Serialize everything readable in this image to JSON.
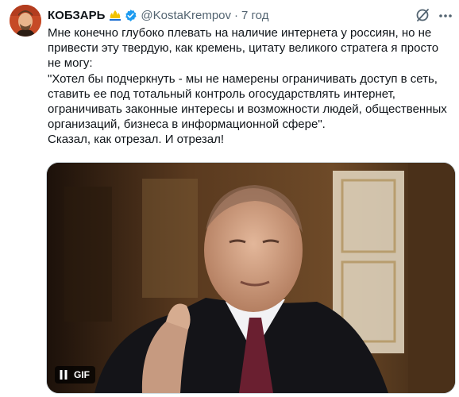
{
  "tweet": {
    "author_name": "КОБЗАРЬ",
    "handle": "@KostaKrempov",
    "separator": "·",
    "time": "7 год",
    "body": [
      "Мне конечно глубоко плевать на наличие интернета у россиян, но не привести эту твердую, как кремень, цитату великого стратега я просто не могу:",
      "\"Хотел бы подчеркнуть - мы не намерены ограничивать доступ в сеть, ставить ее под тотальный контроль огосударствлять интернет, ограничивать законные интересы и возможности людей, общественных организаций, бизнеса в информационной сфере\".",
      "Сказал, как отрезал. И отрезал!"
    ]
  },
  "media": {
    "badge_label": "GIF"
  },
  "icons": {
    "flag": "ukraine-flag-icon",
    "verified": "verified-badge-icon",
    "grok": "grok-icon",
    "more": "more-icon",
    "pause": "pause-icon"
  },
  "colors": {
    "verified_blue": "#1d9bf0",
    "secondary_text": "#536471",
    "text": "#0f1419"
  }
}
